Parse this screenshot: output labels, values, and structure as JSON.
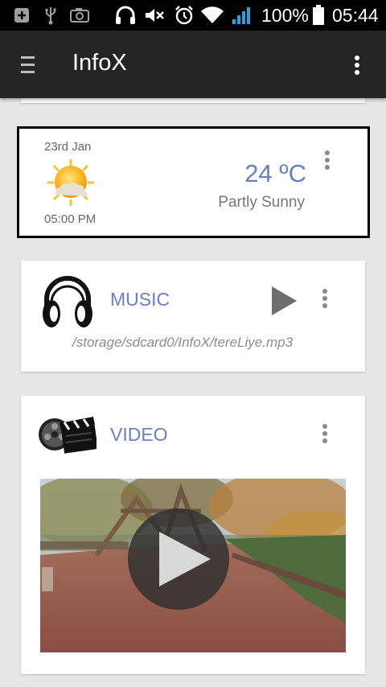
{
  "status_bar": {
    "battery_percent": "100%",
    "time": "05:44",
    "icons": [
      "add-box-icon",
      "usb-icon",
      "screenshot-icon",
      "headphones-icon",
      "mute-icon",
      "alarm-icon",
      "wifi-icon",
      "signal-icon",
      "battery-icon"
    ]
  },
  "app_bar": {
    "title": "InfoX",
    "menu_icon": "hamburger-icon",
    "overflow_icon": "more-vert-icon"
  },
  "weather": {
    "date": "23rd Jan",
    "time": "05:00 PM",
    "temperature": "24 ºC",
    "condition": "Partly Sunny",
    "icon": "partly-sunny-icon"
  },
  "music": {
    "title": "MUSIC",
    "path": "/storage/sdcard0/InfoX/tereLiye.mp3",
    "icon": "headphones-icon",
    "play_icon": "play-icon"
  },
  "video": {
    "title": "VIDEO",
    "icon": "clapperboard-icon",
    "play_icon": "play-circle-icon"
  },
  "colors": {
    "accent": "#6b7fc0",
    "appbar": "#252525",
    "background": "#e6e6e6"
  }
}
